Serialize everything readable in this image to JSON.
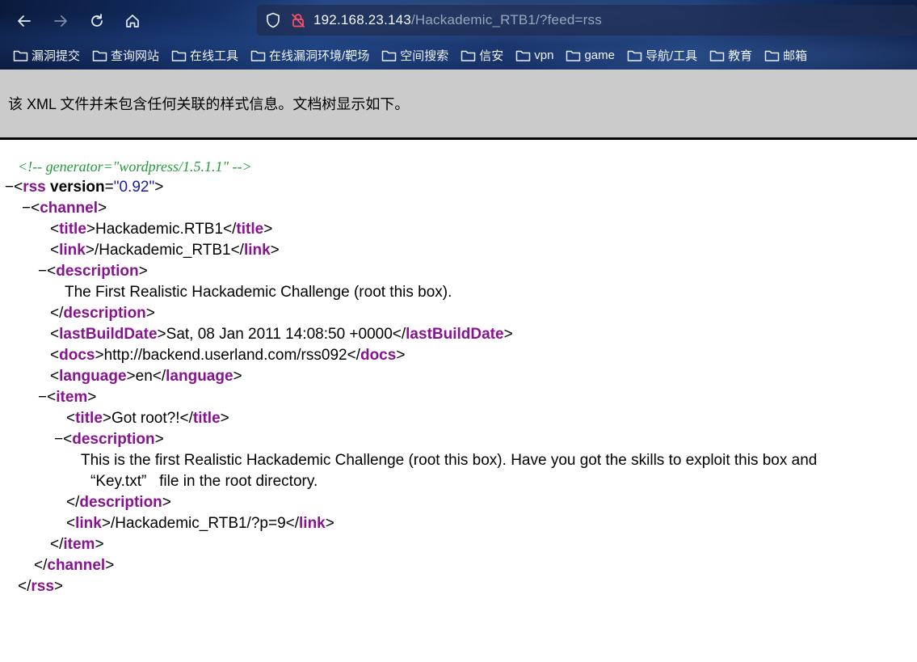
{
  "browser": {
    "url_host": "192.168.23.143",
    "url_path": "/Hackademic_RTB1/?feed=rss",
    "nav": {
      "back_icon": "arrow-left-icon",
      "forward_icon": "arrow-right-icon",
      "reload_icon": "reload-icon",
      "home_icon": "home-icon"
    },
    "bookmarks": [
      {
        "label": "漏洞提交"
      },
      {
        "label": "查询网站"
      },
      {
        "label": "在线工具"
      },
      {
        "label": "在线漏洞环境/靶场"
      },
      {
        "label": "空间搜索"
      },
      {
        "label": "信安"
      },
      {
        "label": "vpn"
      },
      {
        "label": "game"
      },
      {
        "label": "导航/工具"
      },
      {
        "label": "教育"
      },
      {
        "label": "邮箱"
      }
    ]
  },
  "banner": {
    "text": "该 XML 文件并未包含任何关联的样式信息。文档树显示如下。"
  },
  "xml": {
    "comment": "<!-- generator=\"wordpress/1.5.1.1\" -->",
    "toggle": "−",
    "lt": "<",
    "gt": ">",
    "close_lt": "</",
    "rss_tag": "rss",
    "rss_attr_name": "version",
    "eq": "=",
    "rss_attr_value": "\"0.92\"",
    "channel_tag": "channel",
    "title_tag": "title",
    "title_text": "Hackademic.RTB1",
    "link_tag": "link",
    "link_text": "/Hackademic_RTB1",
    "description_tag": "description",
    "description_text": "The First Realistic Hackademic Challenge (root this box).",
    "lastbuild_tag": "lastBuildDate",
    "lastbuild_text": "Sat, 08 Jan 2011 14:08:50 +0000",
    "docs_tag": "docs",
    "docs_text": "http://backend.userland.com/rss092",
    "language_tag": "language",
    "language_text": "en",
    "item_tag": "item",
    "item_title_text": "Got root?!",
    "item_desc_line1": "This is the first Realistic Hackademic Challenge (root this box). Have you got the skills to exploit this box and",
    "item_desc_line2": "“Key.txt”   file in the root directory.",
    "item_link_text": "/Hackademic_RTB1/?p=9"
  }
}
